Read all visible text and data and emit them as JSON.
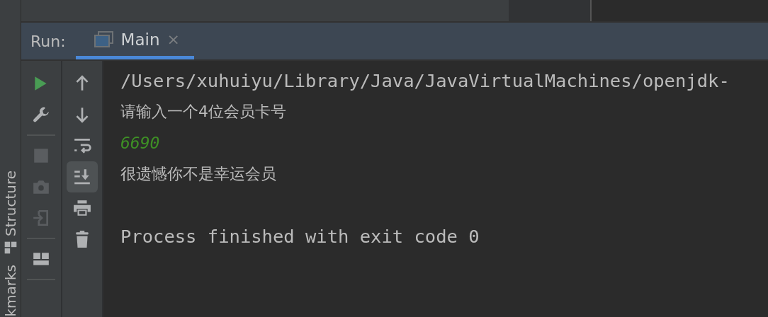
{
  "side_stripe": {
    "labels": [
      {
        "text": "Structure",
        "kind": "structure"
      },
      {
        "text": "kmarks",
        "kind": "bookmarks"
      }
    ]
  },
  "run_panel": {
    "label": "Run:",
    "tabs": [
      {
        "label": "Main",
        "close": "×",
        "selected": true
      }
    ]
  },
  "actions": [
    {
      "kind": "run",
      "disabled": false
    },
    {
      "kind": "wrench",
      "disabled": false
    },
    {
      "kind": "separator"
    },
    {
      "kind": "stop",
      "disabled": true
    },
    {
      "kind": "camera",
      "disabled": true
    },
    {
      "kind": "enter",
      "disabled": true
    },
    {
      "kind": "separator"
    },
    {
      "kind": "layout",
      "disabled": false
    },
    {
      "kind": "separator"
    }
  ],
  "tools": [
    {
      "kind": "up",
      "selected": false
    },
    {
      "kind": "down",
      "selected": false
    },
    {
      "kind": "wrap",
      "selected": false
    },
    {
      "kind": "scroll-end",
      "selected": true
    },
    {
      "kind": "print",
      "selected": false
    },
    {
      "kind": "trash",
      "selected": false
    }
  ],
  "console": [
    {
      "kind": "command",
      "text": "/Users/xuhuiyu/Library/Java/JavaVirtualMachines/openjdk-"
    },
    {
      "kind": "output",
      "text": "请输入一个4位会员卡号"
    },
    {
      "kind": "input",
      "text": "6690"
    },
    {
      "kind": "output",
      "text": "很遗憾你不是幸运会员"
    },
    {
      "kind": "exit",
      "text": "Process finished with exit code 0"
    }
  ]
}
